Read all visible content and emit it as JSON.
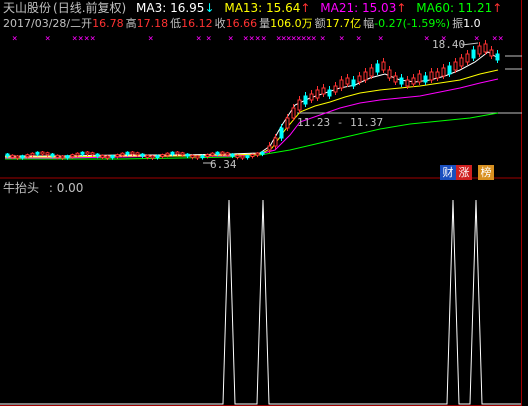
{
  "header": {
    "stock": "天山股份",
    "period": "(日线.前复权)",
    "ma3": "MA3: 16.95",
    "ma13": "MA13: 15.64",
    "ma21": "MA21: 15.03",
    "ma60": "MA60: 11.21",
    "arrow_down": "↓",
    "arrow_up": "↑"
  },
  "ohlc": {
    "date": "2017/03/28/二",
    "open_label": "开",
    "open": "16.78",
    "high_label": "高",
    "high": "17.18",
    "low_label": "低",
    "low": "16.12",
    "close_label": "收",
    "close": "16.66",
    "volume_label": "量",
    "volume": "106.0万",
    "amount_label": "额",
    "amount": "17.7亿",
    "change_label": "幅",
    "change": "-0.27",
    "change_pct": "(-1.59%)",
    "amp_label": "振",
    "amp": "1.0"
  },
  "annotations": {
    "high_price": "18.40",
    "range": "11.23 - 11.37",
    "low_price": "6.34"
  },
  "tags": {
    "cai": "财",
    "zhang": "涨",
    "bang": "榜"
  },
  "indicator": {
    "name": "牛抬头",
    "value": ": 0.00"
  },
  "colors": {
    "up": "#ff3232",
    "down": "#00ffff",
    "ma3": "#ffffff",
    "ma13": "#ffff00",
    "ma21": "#ff00ff",
    "ma60": "#00ff00",
    "axis": "#a00000",
    "signal": "#ffffff"
  },
  "chart_data": {
    "type": "line",
    "title": "牛抬头",
    "series": [
      {
        "name": "牛抬头",
        "values": [
          0,
          0,
          0,
          0,
          0,
          0,
          0,
          0,
          0,
          0,
          0,
          0,
          1,
          0,
          1,
          0,
          0,
          0,
          0,
          0,
          0,
          0,
          0,
          0,
          1,
          0,
          1,
          0,
          0
        ]
      }
    ],
    "current_value": 0.0
  }
}
